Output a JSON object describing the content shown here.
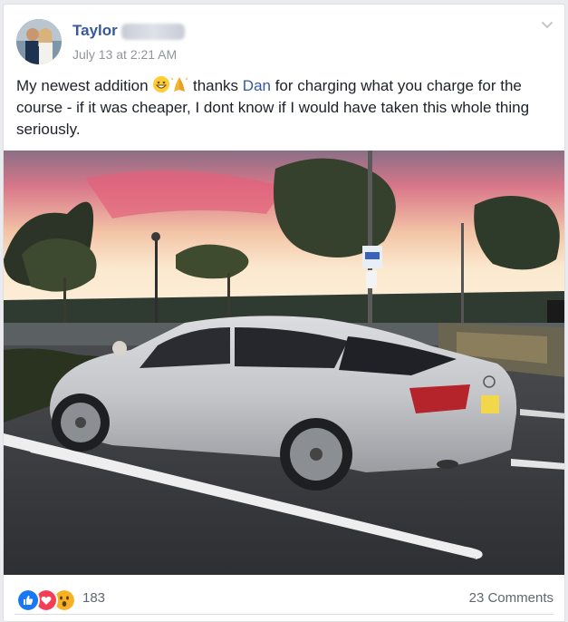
{
  "post": {
    "author": "Taylor",
    "timestamp": "July 13 at 2:21 AM",
    "text_part1": "My newest addition ",
    "text_part2": " thanks ",
    "mention": "Dan",
    "text_part3": " for charging what you charge for the course - if it was cheaper, I dont know if I would have taken this whole thing seriously.",
    "emojis": [
      "grinning-face-icon",
      "folded-hands-icon"
    ]
  },
  "reactions": {
    "icons": [
      "like-icon",
      "love-icon",
      "wow-icon"
    ],
    "count": "183"
  },
  "comments": {
    "label": "23 Comments"
  },
  "colors": {
    "link": "#385898",
    "like": "#1877f2",
    "love": "#f33e58",
    "wow": "#f7b125"
  }
}
